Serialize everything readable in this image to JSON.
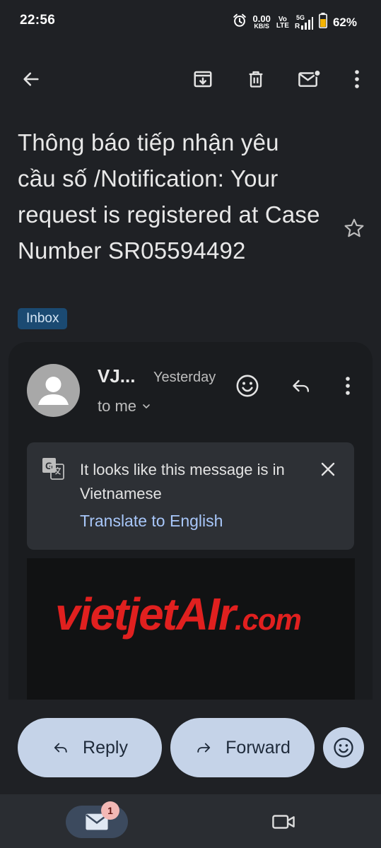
{
  "status_bar": {
    "time": "22:56",
    "net_speed": "0.00",
    "net_unit": "KB/S",
    "volte_top": "Vo",
    "volte_bottom": "LTE",
    "net_type": "5G",
    "roaming": "R",
    "battery": "62%"
  },
  "toolbar": {
    "back_icon": "arrow-left-icon",
    "archive_icon": "archive-icon",
    "delete_icon": "trash-icon",
    "mark_unread_icon": "mark-unread-icon",
    "more_icon": "more-vert-icon"
  },
  "email": {
    "subject": "Thông báo tiếp nhận yêu cầu số /Notification: Your request is registered at Case Number SR05594492",
    "label": "Inbox",
    "sender": "VJ...",
    "time": "Yesterday",
    "recipient": "to me"
  },
  "translate": {
    "message": "It looks like this message is in Vietnamese",
    "action": "Translate to English"
  },
  "banner": {
    "logo_main": "vietjetAIr",
    "logo_suffix": ".com",
    "colors": {
      "logo": "#e1201f",
      "background": "#111213"
    }
  },
  "actions": {
    "reply": "Reply",
    "forward": "Forward"
  },
  "nav": {
    "mail_badge": "1"
  },
  "colors": {
    "background": "#1f2125",
    "card": "#1a1c1f",
    "accent_link": "#a8c7fa",
    "pill": "#c5d3e8",
    "label_badge": "#1b4a72"
  }
}
